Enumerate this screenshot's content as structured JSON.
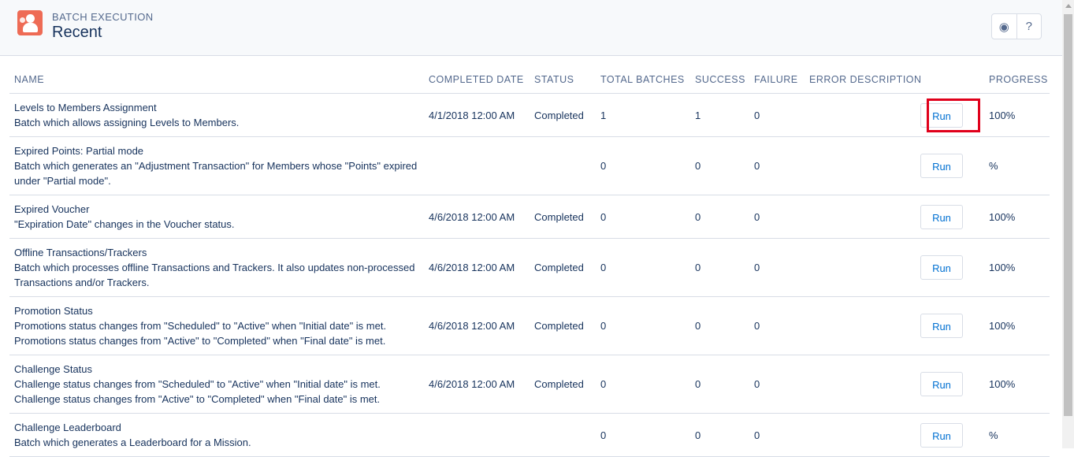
{
  "header": {
    "eyebrow": "BATCH EXECUTION",
    "title": "Recent",
    "app_icon": "user-card-icon",
    "actions": [
      {
        "icon": "help-topics-icon",
        "glyph": "◉"
      },
      {
        "icon": "question-icon",
        "glyph": "?"
      }
    ]
  },
  "table": {
    "columns": [
      "NAME",
      "COMPLETED DATE",
      "STATUS",
      "TOTAL BATCHES",
      "SUCCESS",
      "FAILURE",
      "ERROR DESCRIPTION",
      "",
      "PROGRESS"
    ],
    "rows": [
      {
        "name": "Levels to Members Assignment",
        "description": "Batch which allows assigning Levels to Members.",
        "completed_date": "4/1/2018 12:00 AM",
        "status": "Completed",
        "total_batches": "1",
        "success": "1",
        "failure": "0",
        "error": "",
        "action": "Run",
        "progress": "100%"
      },
      {
        "name": "Expired Points: Partial mode",
        "description": "Batch which generates an \"Adjustment Transaction\" for Members whose \"Points\" expired under \"Partial mode\".",
        "completed_date": "",
        "status": "",
        "total_batches": "0",
        "success": "0",
        "failure": "0",
        "error": "",
        "action": "Run",
        "progress": "%"
      },
      {
        "name": "Expired Voucher",
        "description": "\"Expiration Date\" changes in the Voucher status.",
        "completed_date": "4/6/2018 12:00 AM",
        "status": "Completed",
        "total_batches": "0",
        "success": "0",
        "failure": "0",
        "error": "",
        "action": "Run",
        "progress": "100%"
      },
      {
        "name": "Offline Transactions/Trackers",
        "description": "Batch which processes offline Transactions and Trackers. It also updates non-processed Transactions and/or Trackers.",
        "completed_date": "4/6/2018 12:00 AM",
        "status": "Completed",
        "total_batches": "0",
        "success": "0",
        "failure": "0",
        "error": "",
        "action": "Run",
        "progress": "100%"
      },
      {
        "name": "Promotion Status",
        "description": "Promotions status changes from \"Scheduled\" to \"Active\" when \"Initial date\" is met. Promotions status changes from \"Active\" to \"Completed\" when \"Final date\" is met.",
        "completed_date": "4/6/2018 12:00 AM",
        "status": "Completed",
        "total_batches": "0",
        "success": "0",
        "failure": "0",
        "error": "",
        "action": "Run",
        "progress": "100%"
      },
      {
        "name": "Challenge Status",
        "description": "Challenge status changes from \"Scheduled\" to \"Active\" when \"Initial date\" is met. Challenge status changes from \"Active\" to \"Completed\" when \"Final date\" is met.",
        "completed_date": "4/6/2018 12:00 AM",
        "status": "Completed",
        "total_batches": "0",
        "success": "0",
        "failure": "0",
        "error": "",
        "action": "Run",
        "progress": "100%"
      },
      {
        "name": "Challenge Leaderboard",
        "description": "Batch which generates a Leaderboard for a Mission.",
        "completed_date": "",
        "status": "",
        "total_batches": "0",
        "success": "0",
        "failure": "0",
        "error": "",
        "action": "Run",
        "progress": "%"
      }
    ]
  },
  "highlight": {
    "row": 0,
    "target": "Run",
    "color": "#e0001b"
  },
  "colors": {
    "accent": "#0070d2",
    "icon_bg": "#ee6b55",
    "text": "#16325c",
    "muted": "#54698d",
    "border": "#d8dde6"
  }
}
